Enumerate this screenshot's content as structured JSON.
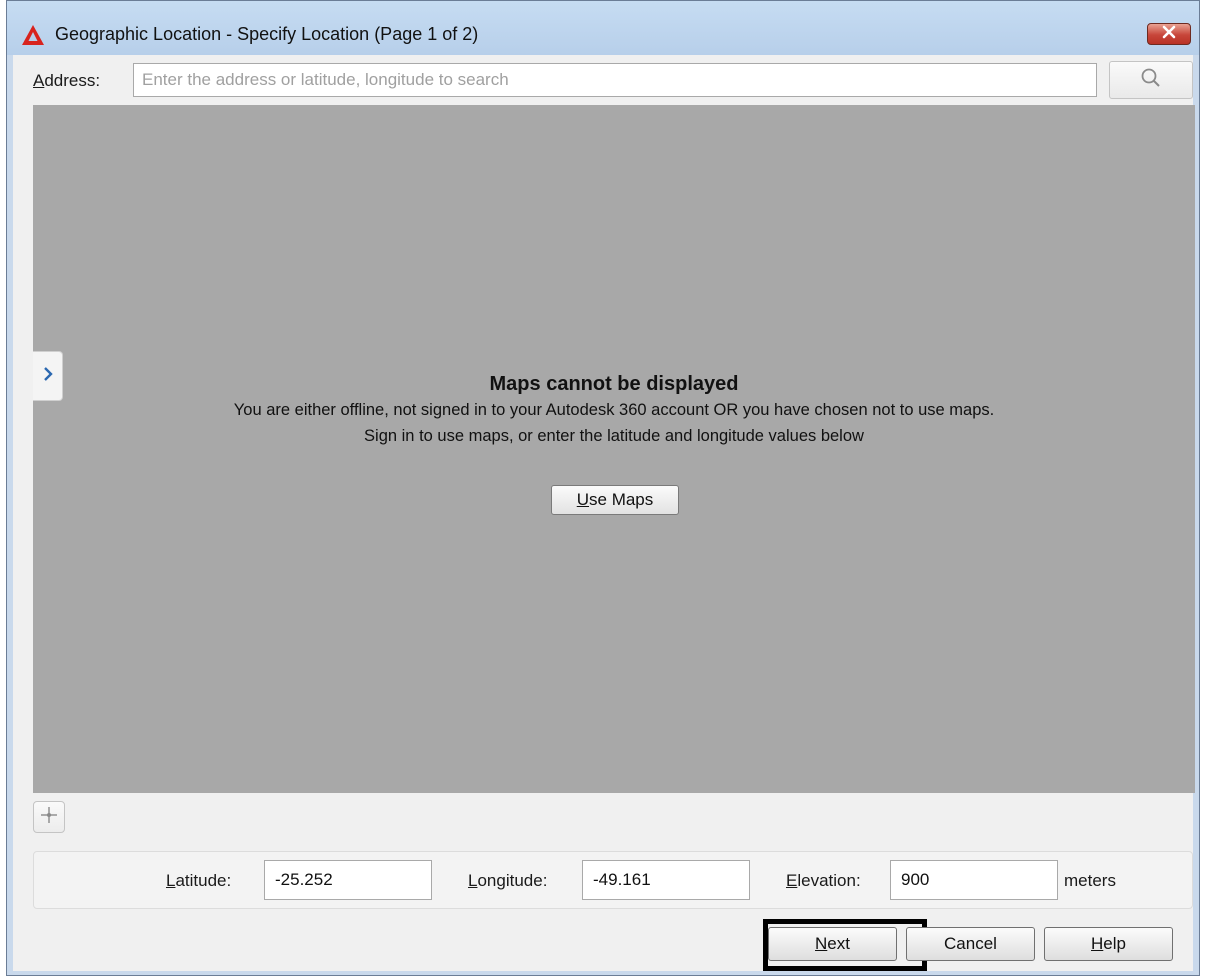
{
  "window": {
    "title": "Geographic Location - Specify Location (Page 1 of 2)",
    "accent": "#c6dcf2"
  },
  "address": {
    "label_prefix": "A",
    "label_rest": "ddress:",
    "placeholder": "Enter the address or latitude, longitude to search",
    "value": ""
  },
  "map": {
    "title": "Maps cannot be displayed",
    "line1": "You are either offline, not signed in to your Autodesk 360 account OR you have chosen not to use maps.",
    "line2": "Sign in to use maps, or enter the latitude and longitude values below",
    "use_maps_prefix": "U",
    "use_maps_rest": "se Maps",
    "background": "#a8a8a8"
  },
  "coords": {
    "latitude_prefix": "L",
    "latitude_rest": "atitude:",
    "latitude_value": "-25.252",
    "longitude_prefix": "L",
    "longitude_rest": "ongitude:",
    "longitude_value": "-49.161",
    "elevation_prefix": "E",
    "elevation_rest": "levation:",
    "elevation_value": "900",
    "units": "meters"
  },
  "buttons": {
    "next_prefix": "N",
    "next_rest": "ext",
    "cancel": "Cancel",
    "help_prefix": "H",
    "help_rest": "elp"
  },
  "icons": {
    "app": "autocad-logo-icon",
    "close": "close-icon",
    "search": "search-icon",
    "expand": "chevron-right-icon",
    "locate": "crosshair-icon"
  }
}
